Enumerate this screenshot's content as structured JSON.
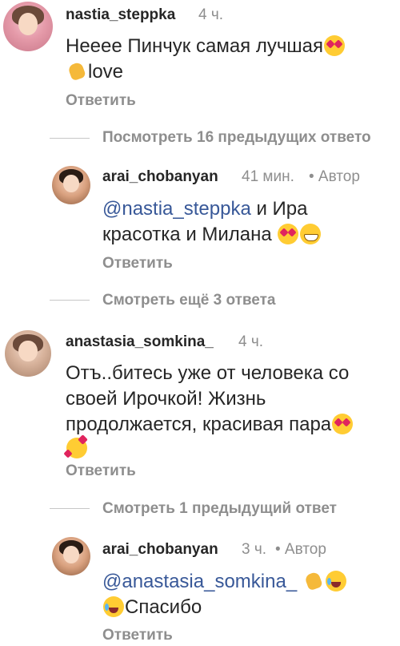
{
  "comments": [
    {
      "username": "nastia_steppka",
      "time": "4 ч.",
      "text_line1": "Нееее Пинчук самая лучшая",
      "text_line2": "love",
      "reply_label": "Ответить",
      "emojis": [
        "heart-eyes-emoji",
        "clapping-hands-emoji"
      ]
    },
    {
      "thread_label": "Посмотреть 16 предыдущих ответо",
      "username": "arai_chobanyan",
      "time": "41 мин.",
      "author_label": "• Автор",
      "mention": "@nastia_steppka",
      "text_line1": "и Ира",
      "text_line2": "красотка и Милана",
      "reply_label": "Ответить",
      "emojis": [
        "heart-eyes-emoji",
        "grinning-emoji"
      ]
    },
    {
      "thread_label": "Смотреть ещё 3 ответа"
    },
    {
      "username": "anastasia_somkina_",
      "time": "4 ч.",
      "text_line1": "Отъ..битесь уже от человека со",
      "text_line2": "своей Ирочкой! Жизнь",
      "text_line3": "продолжается, красивая пара",
      "reply_label": "Ответить",
      "emojis": [
        "heart-eyes-emoji",
        "smiling-face-with-hearts-emoji"
      ]
    },
    {
      "thread_label": "Смотреть 1 предыдущий ответ",
      "username": "arai_chobanyan",
      "time": "3 ч.",
      "author_label": "• Автор",
      "mention": "@anastasia_somkina_",
      "text_line2": "Спасибо",
      "reply_label": "Ответить",
      "emojis": [
        "clapping-hands-emoji",
        "tears-of-joy-emoji"
      ]
    }
  ]
}
